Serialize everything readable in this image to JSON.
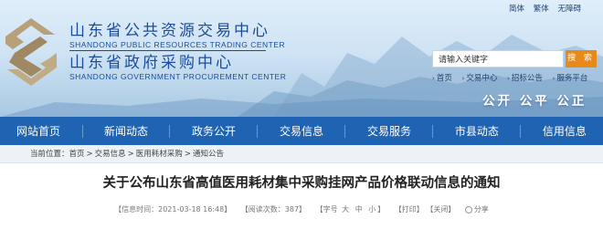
{
  "header": {
    "title_cn_1": "山东省公共资源交易中心",
    "title_en_1": "SHANDONG PUBLIC RESOURCES TRADING CENTER",
    "title_cn_2": "山东省政府采购中心",
    "title_en_2": "SHANDONG GOVERNMENT PROCUREMENT CENTER",
    "lang": [
      "简体",
      "繁体",
      "无障碍"
    ],
    "search_placeholder": "请输入关键字",
    "search_button": "搜 索",
    "quick_links": [
      "首页",
      "交易中心",
      "招标公告",
      "服务平台"
    ],
    "slogan": "公开 公平 公正"
  },
  "nav": {
    "items": [
      "网站首页",
      "新闻动态",
      "政务公开",
      "交易信息",
      "交易服务",
      "市县动态",
      "信用信息"
    ]
  },
  "breadcrumb": {
    "prefix": "当前位置：",
    "items": [
      "首页",
      "交易信息",
      "医用耗材采购",
      "通知公告"
    ]
  },
  "article": {
    "title": "关于公布山东省高值医用耗材集中采购挂网产品价格联动信息的通知",
    "meta": {
      "time_label": "【信息时间：",
      "time_value": "2021-03-18 16:48",
      "time_end": "】",
      "views_label": "【阅读次数：",
      "views_value": "387",
      "views_end": "】",
      "font_label": "【字号",
      "font_sizes": [
        "大",
        "中",
        "小"
      ],
      "font_end": "】",
      "print": "【打印】",
      "close": "【关闭】",
      "share": "分享"
    }
  },
  "colors": {
    "nav_bg": "#1f63b3",
    "title_blue": "#1c4c9a",
    "search_btn": "#e88a1a"
  }
}
